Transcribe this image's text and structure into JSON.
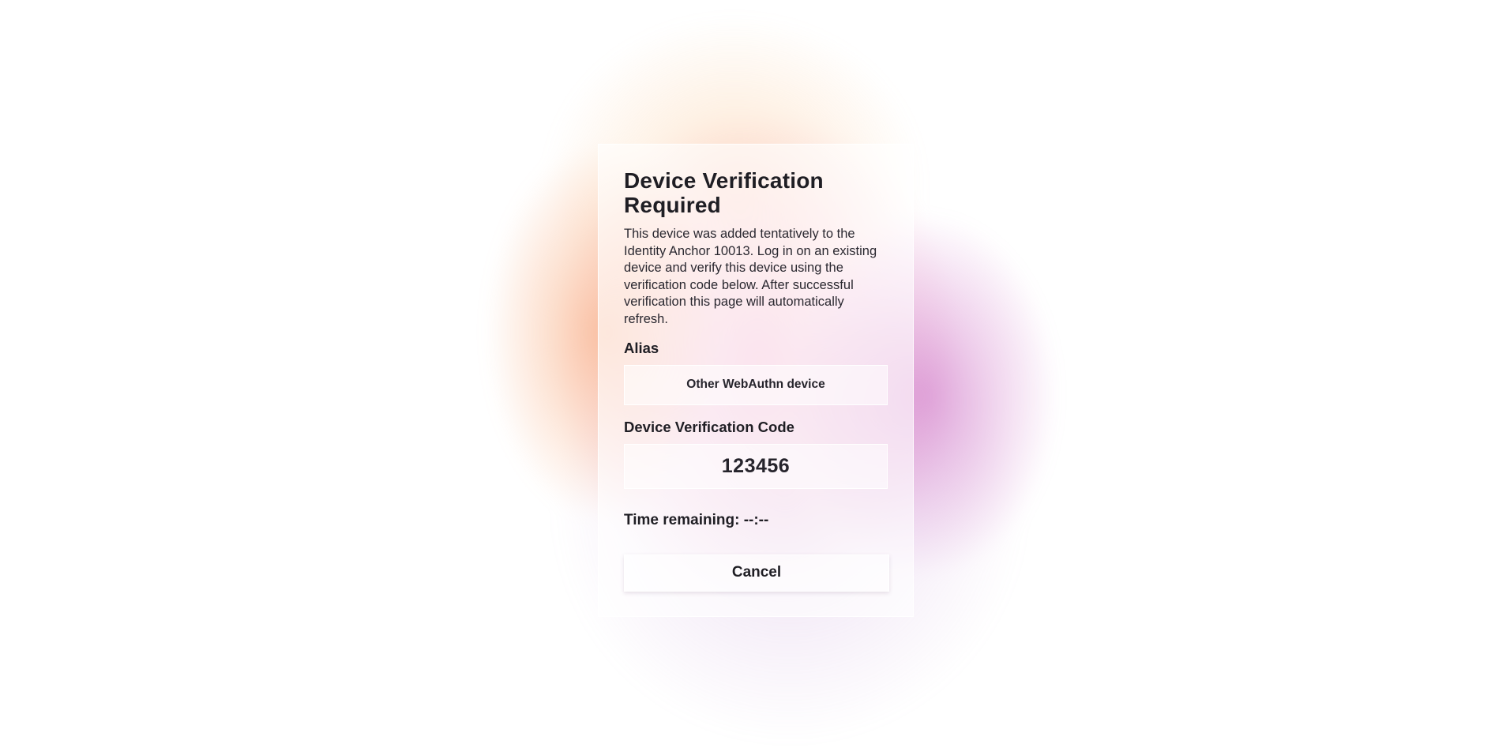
{
  "dialog": {
    "title": "Device Verification Required",
    "description": "This device was added tentatively to the Identity Anchor 10013. Log in on an existing device and verify this device using the verification code below. After successful verification this page will automatically refresh.",
    "alias_label": "Alias",
    "alias_value": "Other WebAuthn device",
    "code_label": "Device Verification Code",
    "code_value": "123456",
    "timer_label": "Time remaining:",
    "timer_value": "--:--",
    "cancel_label": "Cancel"
  }
}
